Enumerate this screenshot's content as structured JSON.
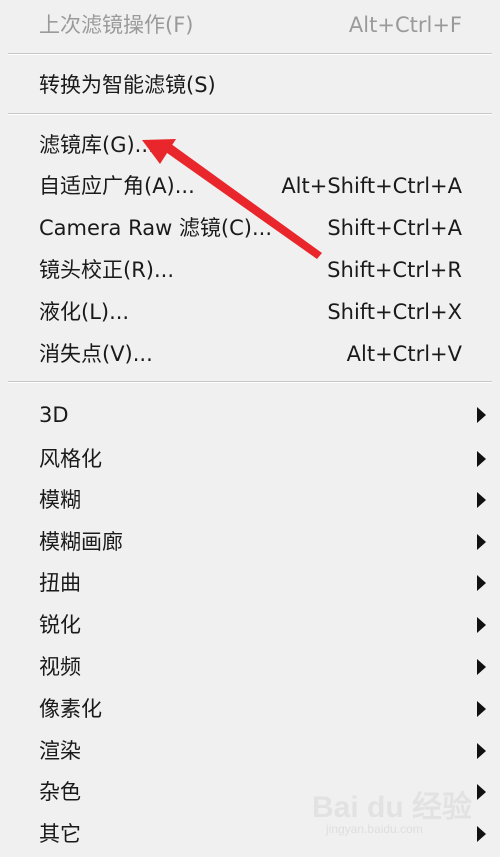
{
  "menu": {
    "items": [
      {
        "label": "上次滤镜操作(F)",
        "shortcut": "Alt+Ctrl+F"
      },
      {
        "label": "转换为智能滤镜(S)"
      },
      {
        "label": "滤镜库(G)..."
      },
      {
        "label": "自适应广角(A)...",
        "shortcut": "Alt+Shift+Ctrl+A"
      },
      {
        "label": "Camera Raw 滤镜(C)...",
        "shortcut": "Shift+Ctrl+A"
      },
      {
        "label": "镜头校正(R)...",
        "shortcut": "Shift+Ctrl+R"
      },
      {
        "label": "液化(L)...",
        "shortcut": "Shift+Ctrl+X"
      },
      {
        "label": "消失点(V)...",
        "shortcut": "Alt+Ctrl+V"
      },
      {
        "label": "3D"
      },
      {
        "label": "风格化"
      },
      {
        "label": "模糊"
      },
      {
        "label": "模糊画廊"
      },
      {
        "label": "扭曲"
      },
      {
        "label": "锐化"
      },
      {
        "label": "视频"
      },
      {
        "label": "像素化"
      },
      {
        "label": "渲染"
      },
      {
        "label": "杂色"
      },
      {
        "label": "其它"
      }
    ]
  },
  "annotation": {
    "color": "#e8262b"
  },
  "watermark": {
    "text": "Bai du 经验",
    "sub": "jingyan.baidu.com"
  }
}
